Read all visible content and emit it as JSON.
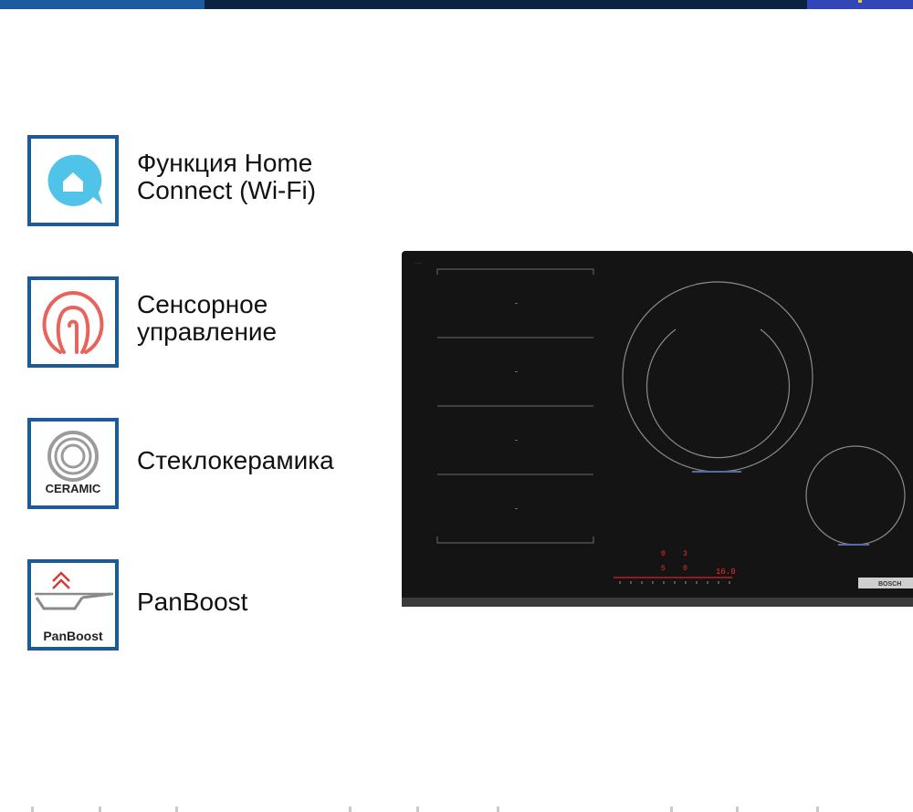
{
  "features": [
    {
      "label": "Функция Home\nConnect (Wi-Fi)",
      "icon": "home-connect-icon"
    },
    {
      "label": "Сенсорное\nуправление",
      "icon": "touch-control-icon"
    },
    {
      "label": "Стеклокерамика",
      "icon": "ceramic-icon",
      "badge_text": "CERAMIC"
    },
    {
      "label": "PanBoost",
      "icon": "panboost-icon",
      "badge_text": "PanBoost"
    }
  ],
  "hob": {
    "brand": "BOSCH",
    "display": [
      "0",
      "3",
      "5",
      "0",
      "16.0"
    ]
  },
  "colors": {
    "accent_blue": "#1d5a98",
    "home_connect": "#4fc3e8",
    "touch": "#e8645a",
    "panboost_arrow": "#d63b3b",
    "hob_display": "#ff2a2a"
  }
}
